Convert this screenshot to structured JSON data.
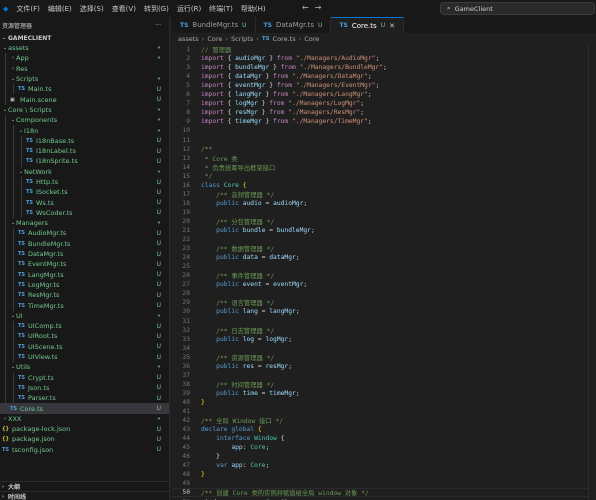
{
  "menu": [
    "文件(F)",
    "编辑(E)",
    "选择(S)",
    "查看(V)",
    "转到(G)",
    "运行(R)",
    "终端(T)",
    "帮助(H)"
  ],
  "search_label": "GameClient",
  "tabs": [
    {
      "label": "BundleMgr.ts",
      "status": "U",
      "active": false
    },
    {
      "label": "DataMgr.ts",
      "status": "U",
      "active": false
    },
    {
      "label": "Core.ts",
      "status": "U",
      "active": true
    }
  ],
  "explorer": {
    "title": "资源管理器",
    "more": "···",
    "project": "GAMECLIENT",
    "outline_label": "大纲",
    "timeline_label": "时间线"
  },
  "tree": [
    {
      "depth": 0,
      "folder": true,
      "open": true,
      "name": "assets",
      "status": "•",
      "plain": false
    },
    {
      "depth": 1,
      "folder": true,
      "open": false,
      "name": "App",
      "status": "•"
    },
    {
      "depth": 1,
      "folder": true,
      "open": false,
      "name": "Res",
      "status": ""
    },
    {
      "depth": 1,
      "folder": true,
      "open": true,
      "name": "Scripts",
      "status": "•"
    },
    {
      "depth": 2,
      "folder": false,
      "icon": "TS",
      "name": "Main.ts",
      "status": "U"
    },
    {
      "depth": 1,
      "folder": false,
      "icon": "scene",
      "name": "Main.scene",
      "status": "U"
    },
    {
      "depth": 0,
      "folder": true,
      "open": true,
      "name": "Core \\ Scripts",
      "status": "•"
    },
    {
      "depth": 1,
      "folder": true,
      "open": true,
      "name": "Components",
      "status": "•"
    },
    {
      "depth": 2,
      "folder": true,
      "open": true,
      "name": "I18n",
      "status": "•"
    },
    {
      "depth": 3,
      "folder": false,
      "icon": "TS",
      "name": "I18nBase.ts",
      "status": "U"
    },
    {
      "depth": 3,
      "folder": false,
      "icon": "TS",
      "name": "I18nLabel.ts",
      "status": "U"
    },
    {
      "depth": 3,
      "folder": false,
      "icon": "TS",
      "name": "I18nSprite.ts",
      "status": "U"
    },
    {
      "depth": 2,
      "folder": true,
      "open": true,
      "name": "NetWork",
      "status": "•"
    },
    {
      "depth": 3,
      "folder": false,
      "icon": "TS",
      "name": "Http.ts",
      "status": "U"
    },
    {
      "depth": 3,
      "folder": false,
      "icon": "TS",
      "name": "ISocket.ts",
      "status": "U"
    },
    {
      "depth": 3,
      "folder": false,
      "icon": "TS",
      "name": "Ws.ts",
      "status": "U"
    },
    {
      "depth": 3,
      "folder": false,
      "icon": "TS",
      "name": "WsCoder.ts",
      "status": "U"
    },
    {
      "depth": 1,
      "folder": true,
      "open": true,
      "name": "Managers",
      "status": "•"
    },
    {
      "depth": 2,
      "folder": false,
      "icon": "TS",
      "name": "AudioMgr.ts",
      "status": "U"
    },
    {
      "depth": 2,
      "folder": false,
      "icon": "TS",
      "name": "BundleMgr.ts",
      "status": "U"
    },
    {
      "depth": 2,
      "folder": false,
      "icon": "TS",
      "name": "DataMgr.ts",
      "status": "U"
    },
    {
      "depth": 2,
      "folder": false,
      "icon": "TS",
      "name": "EventMgr.ts",
      "status": "U"
    },
    {
      "depth": 2,
      "folder": false,
      "icon": "TS",
      "name": "LangMgr.ts",
      "status": "U"
    },
    {
      "depth": 2,
      "folder": false,
      "icon": "TS",
      "name": "LogMgr.ts",
      "status": "U"
    },
    {
      "depth": 2,
      "folder": false,
      "icon": "TS",
      "name": "ResMgr.ts",
      "status": "U"
    },
    {
      "depth": 2,
      "folder": false,
      "icon": "TS",
      "name": "TimeMgr.ts",
      "status": "U"
    },
    {
      "depth": 1,
      "folder": true,
      "open": true,
      "name": "UI",
      "status": "•"
    },
    {
      "depth": 2,
      "folder": false,
      "icon": "TS",
      "name": "UIComp.ts",
      "status": "U"
    },
    {
      "depth": 2,
      "folder": false,
      "icon": "TS",
      "name": "UIRoot.ts",
      "status": "U"
    },
    {
      "depth": 2,
      "folder": false,
      "icon": "TS",
      "name": "UIScene.ts",
      "status": "U"
    },
    {
      "depth": 2,
      "folder": false,
      "icon": "TS",
      "name": "UIView.ts",
      "status": "U"
    },
    {
      "depth": 1,
      "folder": true,
      "open": true,
      "name": "Utils",
      "status": "•"
    },
    {
      "depth": 2,
      "folder": false,
      "icon": "TS",
      "name": "Crypt.ts",
      "status": "U"
    },
    {
      "depth": 2,
      "folder": false,
      "icon": "TS",
      "name": "Json.ts",
      "status": "U"
    },
    {
      "depth": 2,
      "folder": false,
      "icon": "TS",
      "name": "Parser.ts",
      "status": "U"
    },
    {
      "depth": 1,
      "folder": false,
      "icon": "TS",
      "name": "Core.ts",
      "status": "U",
      "selected": true
    },
    {
      "depth": 0,
      "folder": true,
      "open": false,
      "name": "XXX",
      "status": "•"
    },
    {
      "depth": 0,
      "folder": false,
      "icon": "{}",
      "name": "package-lock.json",
      "status": "U"
    },
    {
      "depth": 0,
      "folder": false,
      "icon": "{}",
      "name": "package.json",
      "status": "U"
    },
    {
      "depth": 0,
      "folder": false,
      "icon": "TS",
      "name": "tsconfig.json",
      "status": "U"
    }
  ],
  "breadcrumb": [
    "assets",
    "Core",
    "Scripts",
    "Core.ts",
    "Core"
  ],
  "current_line": 50,
  "code_lines": [
    [
      [
        "c-com",
        "// 管理器"
      ]
    ],
    [
      [
        "c-kw",
        "import"
      ],
      [
        "c-punc",
        " { "
      ],
      [
        "c-var",
        "audioMgr"
      ],
      [
        "c-punc",
        " } "
      ],
      [
        "c-kw",
        "from"
      ],
      [
        "c-punc",
        " "
      ],
      [
        "c-str",
        "\"./Managers/AudioMgr\""
      ],
      [
        "c-punc",
        ";"
      ]
    ],
    [
      [
        "c-kw",
        "import"
      ],
      [
        "c-punc",
        " { "
      ],
      [
        "c-var",
        "bundleMgr"
      ],
      [
        "c-punc",
        " } "
      ],
      [
        "c-kw",
        "from"
      ],
      [
        "c-punc",
        " "
      ],
      [
        "c-str",
        "\"./Managers/BundleMgr\""
      ],
      [
        "c-punc",
        ";"
      ]
    ],
    [
      [
        "c-kw",
        "import"
      ],
      [
        "c-punc",
        " { "
      ],
      [
        "c-var",
        "dataMgr"
      ],
      [
        "c-punc",
        " } "
      ],
      [
        "c-kw",
        "from"
      ],
      [
        "c-punc",
        " "
      ],
      [
        "c-str",
        "\"./Managers/DataMgr\""
      ],
      [
        "c-punc",
        ";"
      ]
    ],
    [
      [
        "c-kw",
        "import"
      ],
      [
        "c-punc",
        " { "
      ],
      [
        "c-var",
        "eventMgr"
      ],
      [
        "c-punc",
        " } "
      ],
      [
        "c-kw",
        "from"
      ],
      [
        "c-punc",
        " "
      ],
      [
        "c-str",
        "\"./Managers/EventMgr\""
      ],
      [
        "c-punc",
        ";"
      ]
    ],
    [
      [
        "c-kw",
        "import"
      ],
      [
        "c-punc",
        " { "
      ],
      [
        "c-var",
        "langMgr"
      ],
      [
        "c-punc",
        " } "
      ],
      [
        "c-kw",
        "from"
      ],
      [
        "c-punc",
        " "
      ],
      [
        "c-str",
        "\"./Managers/LangMgr\""
      ],
      [
        "c-punc",
        ";"
      ]
    ],
    [
      [
        "c-kw",
        "import"
      ],
      [
        "c-punc",
        " { "
      ],
      [
        "c-var",
        "logMgr"
      ],
      [
        "c-punc",
        " } "
      ],
      [
        "c-kw",
        "from"
      ],
      [
        "c-punc",
        " "
      ],
      [
        "c-str",
        "\"./Managers/LogMgr\""
      ],
      [
        "c-punc",
        ";"
      ]
    ],
    [
      [
        "c-kw",
        "import"
      ],
      [
        "c-punc",
        " { "
      ],
      [
        "c-var",
        "resMgr"
      ],
      [
        "c-punc",
        " } "
      ],
      [
        "c-kw",
        "from"
      ],
      [
        "c-punc",
        " "
      ],
      [
        "c-str",
        "\"./Managers/ResMgr\""
      ],
      [
        "c-punc",
        ";"
      ]
    ],
    [
      [
        "c-kw",
        "import"
      ],
      [
        "c-punc",
        " { "
      ],
      [
        "c-var",
        "timeMgr"
      ],
      [
        "c-punc",
        " } "
      ],
      [
        "c-kw",
        "from"
      ],
      [
        "c-punc",
        " "
      ],
      [
        "c-str",
        "\"./Managers/TimeMgr\""
      ],
      [
        "c-punc",
        ";"
      ]
    ],
    [],
    [],
    [
      [
        "c-com",
        "/**"
      ]
    ],
    [
      [
        "c-com",
        " * Core 类"
      ]
    ],
    [
      [
        "c-com",
        " * 负责统筹导出框架接口"
      ]
    ],
    [
      [
        "c-com",
        " */"
      ]
    ],
    [
      [
        "c-kw2",
        "class"
      ],
      [
        "c-punc",
        " "
      ],
      [
        "c-type",
        "Core"
      ],
      [
        "c-punc",
        " "
      ],
      [
        "c-brace",
        "{"
      ]
    ],
    [
      [
        "c-punc",
        "    "
      ],
      [
        "c-com",
        "/** 音频管理器 */"
      ]
    ],
    [
      [
        "c-punc",
        "    "
      ],
      [
        "c-kw2",
        "public"
      ],
      [
        "c-punc",
        " "
      ],
      [
        "c-var",
        "audio"
      ],
      [
        "c-punc",
        " = "
      ],
      [
        "c-var",
        "audioMgr"
      ],
      [
        "c-punc",
        ";"
      ]
    ],
    [],
    [
      [
        "c-punc",
        "    "
      ],
      [
        "c-com",
        "/** 分包管理器 */"
      ]
    ],
    [
      [
        "c-punc",
        "    "
      ],
      [
        "c-kw2",
        "public"
      ],
      [
        "c-punc",
        " "
      ],
      [
        "c-var",
        "bundle"
      ],
      [
        "c-punc",
        " = "
      ],
      [
        "c-var",
        "bundleMgr"
      ],
      [
        "c-punc",
        ";"
      ]
    ],
    [],
    [
      [
        "c-punc",
        "    "
      ],
      [
        "c-com",
        "/** 数据管理器 */"
      ]
    ],
    [
      [
        "c-punc",
        "    "
      ],
      [
        "c-kw2",
        "public"
      ],
      [
        "c-punc",
        " "
      ],
      [
        "c-var",
        "data"
      ],
      [
        "c-punc",
        " = "
      ],
      [
        "c-var",
        "dataMgr"
      ],
      [
        "c-punc",
        ";"
      ]
    ],
    [],
    [
      [
        "c-punc",
        "    "
      ],
      [
        "c-com",
        "/** 事件管理器 */"
      ]
    ],
    [
      [
        "c-punc",
        "    "
      ],
      [
        "c-kw2",
        "public"
      ],
      [
        "c-punc",
        " "
      ],
      [
        "c-var",
        "event"
      ],
      [
        "c-punc",
        " = "
      ],
      [
        "c-var",
        "eventMgr"
      ],
      [
        "c-punc",
        ";"
      ]
    ],
    [],
    [
      [
        "c-punc",
        "    "
      ],
      [
        "c-com",
        "/** 语言管理器 */"
      ]
    ],
    [
      [
        "c-punc",
        "    "
      ],
      [
        "c-kw2",
        "public"
      ],
      [
        "c-punc",
        " "
      ],
      [
        "c-var",
        "lang"
      ],
      [
        "c-punc",
        " = "
      ],
      [
        "c-var",
        "langMgr"
      ],
      [
        "c-punc",
        ";"
      ]
    ],
    [],
    [
      [
        "c-punc",
        "    "
      ],
      [
        "c-com",
        "/** 日志管理器 */"
      ]
    ],
    [
      [
        "c-punc",
        "    "
      ],
      [
        "c-kw2",
        "public"
      ],
      [
        "c-punc",
        " "
      ],
      [
        "c-var",
        "log"
      ],
      [
        "c-punc",
        " = "
      ],
      [
        "c-var",
        "logMgr"
      ],
      [
        "c-punc",
        ";"
      ]
    ],
    [],
    [
      [
        "c-punc",
        "    "
      ],
      [
        "c-com",
        "/** 资源管理器 */"
      ]
    ],
    [
      [
        "c-punc",
        "    "
      ],
      [
        "c-kw2",
        "public"
      ],
      [
        "c-punc",
        " "
      ],
      [
        "c-var",
        "res"
      ],
      [
        "c-punc",
        " = "
      ],
      [
        "c-var",
        "resMgr"
      ],
      [
        "c-punc",
        ";"
      ]
    ],
    [],
    [
      [
        "c-punc",
        "    "
      ],
      [
        "c-com",
        "/** 时间管理器 */"
      ]
    ],
    [
      [
        "c-punc",
        "    "
      ],
      [
        "c-kw2",
        "public"
      ],
      [
        "c-punc",
        " "
      ],
      [
        "c-var",
        "time"
      ],
      [
        "c-punc",
        " = "
      ],
      [
        "c-var",
        "timeMgr"
      ],
      [
        "c-punc",
        ";"
      ]
    ],
    [
      [
        "c-brace",
        "}"
      ]
    ],
    [],
    [
      [
        "c-com",
        "/** 全局 Window 接口 */"
      ]
    ],
    [
      [
        "c-kw2",
        "declare"
      ],
      [
        "c-punc",
        " "
      ],
      [
        "c-kw2",
        "global"
      ],
      [
        "c-punc",
        " "
      ],
      [
        "c-brace",
        "{"
      ]
    ],
    [
      [
        "c-punc",
        "    "
      ],
      [
        "c-kw2",
        "interface"
      ],
      [
        "c-punc",
        " "
      ],
      [
        "c-type",
        "Window"
      ],
      [
        "c-punc",
        " {"
      ]
    ],
    [
      [
        "c-punc",
        "        "
      ],
      [
        "c-var",
        "app"
      ],
      [
        "c-punc",
        ": "
      ],
      [
        "c-type",
        "Core"
      ],
      [
        "c-punc",
        ";"
      ]
    ],
    [
      [
        "c-punc",
        "    }"
      ]
    ],
    [
      [
        "c-punc",
        "    "
      ],
      [
        "c-kw2",
        "var"
      ],
      [
        "c-punc",
        " "
      ],
      [
        "c-var",
        "app"
      ],
      [
        "c-punc",
        ": "
      ],
      [
        "c-type",
        "Core"
      ],
      [
        "c-punc",
        ";"
      ]
    ],
    [
      [
        "c-brace",
        "}"
      ]
    ],
    [],
    [
      [
        "c-com",
        "/** 创建 Core 类的实例并赋值给全局 window 对象 */"
      ]
    ],
    [
      [
        "c-var",
        "window"
      ],
      [
        "c-punc",
        "."
      ],
      [
        "c-var",
        "app"
      ],
      [
        "c-punc",
        " = "
      ],
      [
        "c-kw2",
        "new"
      ],
      [
        "c-punc",
        " "
      ],
      [
        "c-type",
        "Core"
      ],
      [
        "c-punc",
        "();"
      ]
    ]
  ]
}
